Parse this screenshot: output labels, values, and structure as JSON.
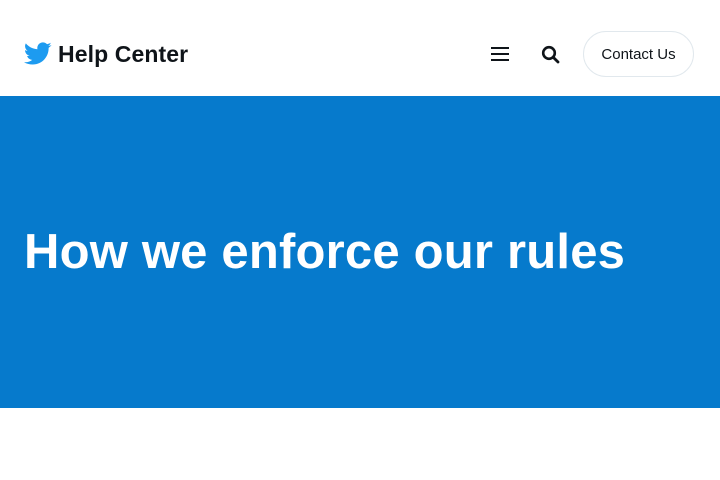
{
  "header": {
    "brand_title": "Help Center",
    "logo_icon": "twitter-bird-icon",
    "menu_icon": "hamburger-menu-icon",
    "search_icon": "search-icon",
    "contact_label": "Contact Us"
  },
  "hero": {
    "title": "How we enforce our rules"
  },
  "colors": {
    "brand_blue": "#1d9bf0",
    "hero_background": "#067acc",
    "text_dark": "#0f1419",
    "button_border": "#e1e8ed"
  }
}
